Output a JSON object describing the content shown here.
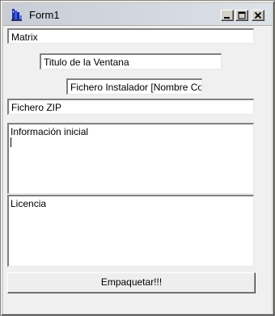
{
  "window": {
    "title": "Form1"
  },
  "fields": {
    "matrix": "Matrix",
    "window_title": "Titulo de la Ventana",
    "installer_file": "Fichero Instalador [Nombre Corto]",
    "zip_file": "Fichero ZIP"
  },
  "memos": {
    "initial_info": "Información inicial",
    "license": "Licencia"
  },
  "buttons": {
    "package": "Empaquetar!!!"
  },
  "icons": {
    "app": "app-icon",
    "minimize": "minimize-icon",
    "maximize": "maximize-icon",
    "close": "close-icon"
  }
}
